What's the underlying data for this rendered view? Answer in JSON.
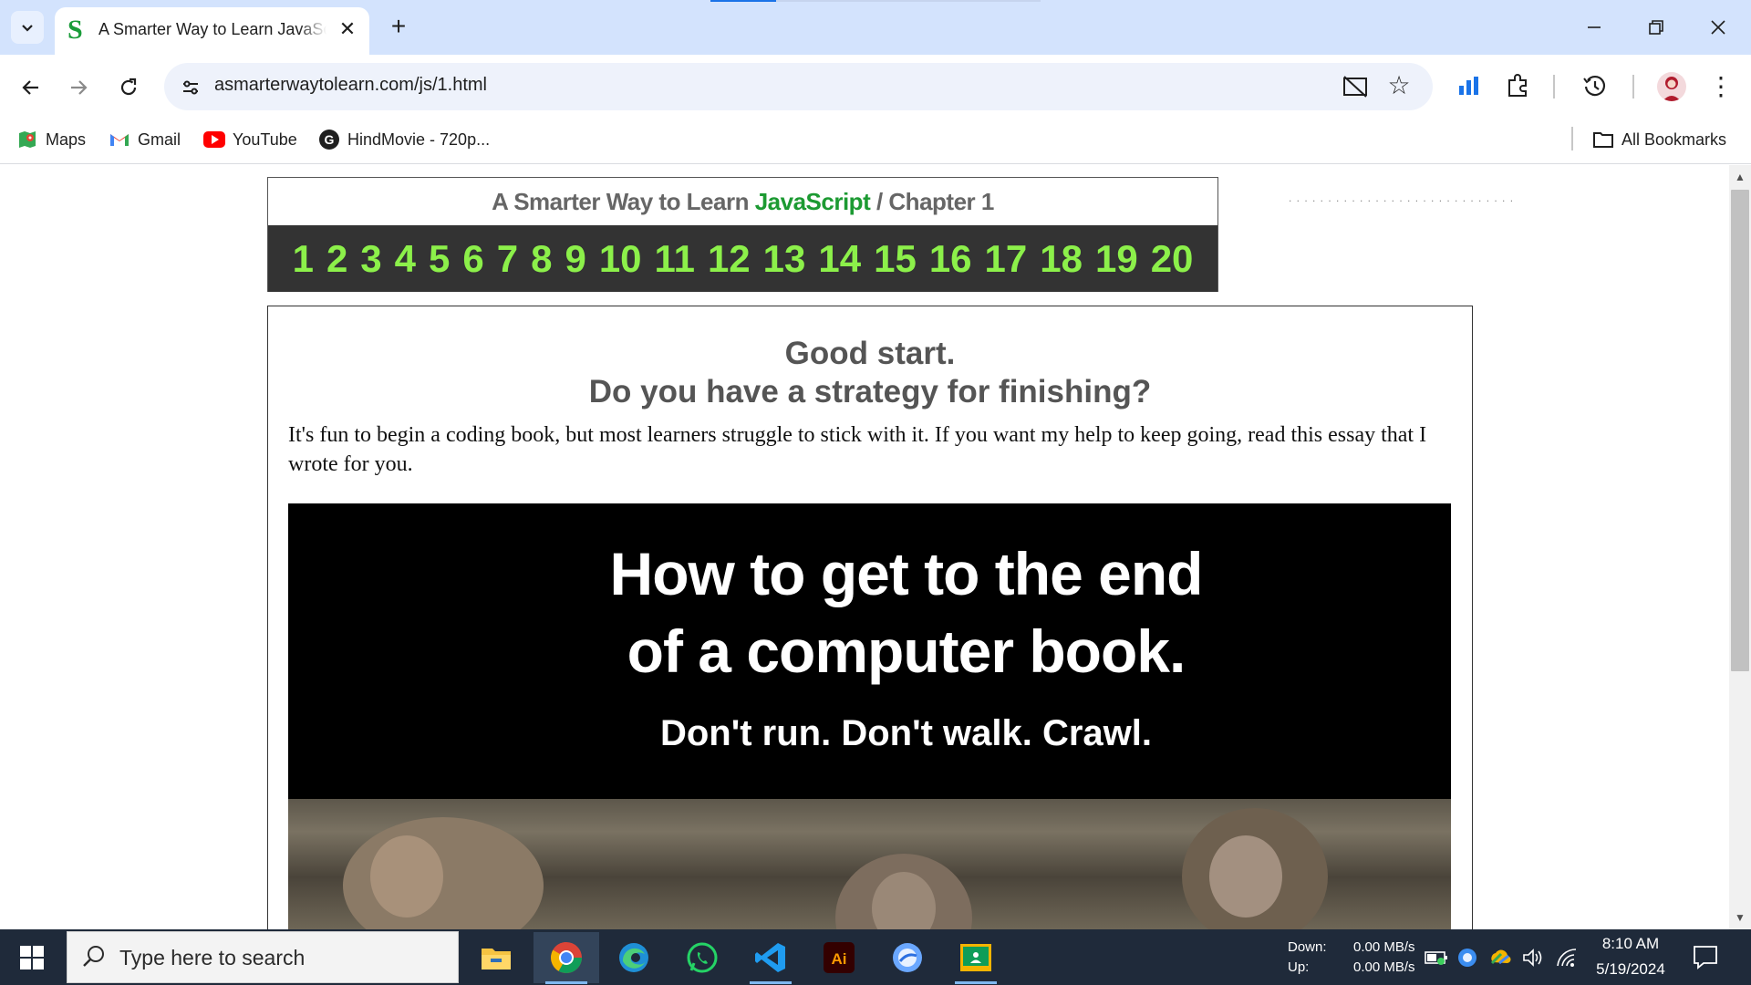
{
  "browser": {
    "tab_title": "A Smarter Way to Learn JavaScript",
    "tab_favicon": "S",
    "tab_close": "✕",
    "new_tab": "+",
    "url": "asmarterwaytolearn.com/js/1.html",
    "accent_color": "#1a73e8"
  },
  "bookmarks": [
    {
      "label": "Maps",
      "icon": "maps-icon"
    },
    {
      "label": "Gmail",
      "icon": "gmail-icon"
    },
    {
      "label": "YouTube",
      "icon": "youtube-icon"
    },
    {
      "label": "HindMovie - 720p...",
      "icon": "g-icon"
    }
  ],
  "all_bookmarks": "All Bookmarks",
  "page": {
    "header_prefix": "A Smarter Way to Learn ",
    "header_js": "JavaScript",
    "header_suffix": " / Chapter 1",
    "chapters": [
      "1",
      "2",
      "3",
      "4",
      "5",
      "6",
      "7",
      "8",
      "9",
      "10",
      "11",
      "12",
      "13",
      "14",
      "15",
      "16",
      "17",
      "18",
      "19",
      "20"
    ],
    "heading1": "Good start.",
    "heading2": "Do you have a strategy for finishing?",
    "body": "It's fun to begin a coding book, but most learners struggle to stick with it. If you want my help to keep going, read this essay that I wrote for you.",
    "promo_title1": "How to get to the end",
    "promo_title2": "of a computer book.",
    "promo_sub": "Don't run. Don't walk. Crawl.",
    "chapter_color": "#8cf04a",
    "js_color": "#1c9a32"
  },
  "taskbar": {
    "search_placeholder": "Type here to search",
    "down_label": "Down:",
    "up_label": "Up:",
    "down_value": "0.00 MB/s",
    "up_value": "0.00 MB/s",
    "time": "8:10 AM",
    "date": "5/19/2024",
    "apps": [
      "file-explorer-icon",
      "chrome-icon",
      "edge-icon",
      "whatsapp-icon",
      "vscode-icon",
      "illustrator-icon",
      "browser-app-icon",
      "classroom-icon"
    ]
  }
}
